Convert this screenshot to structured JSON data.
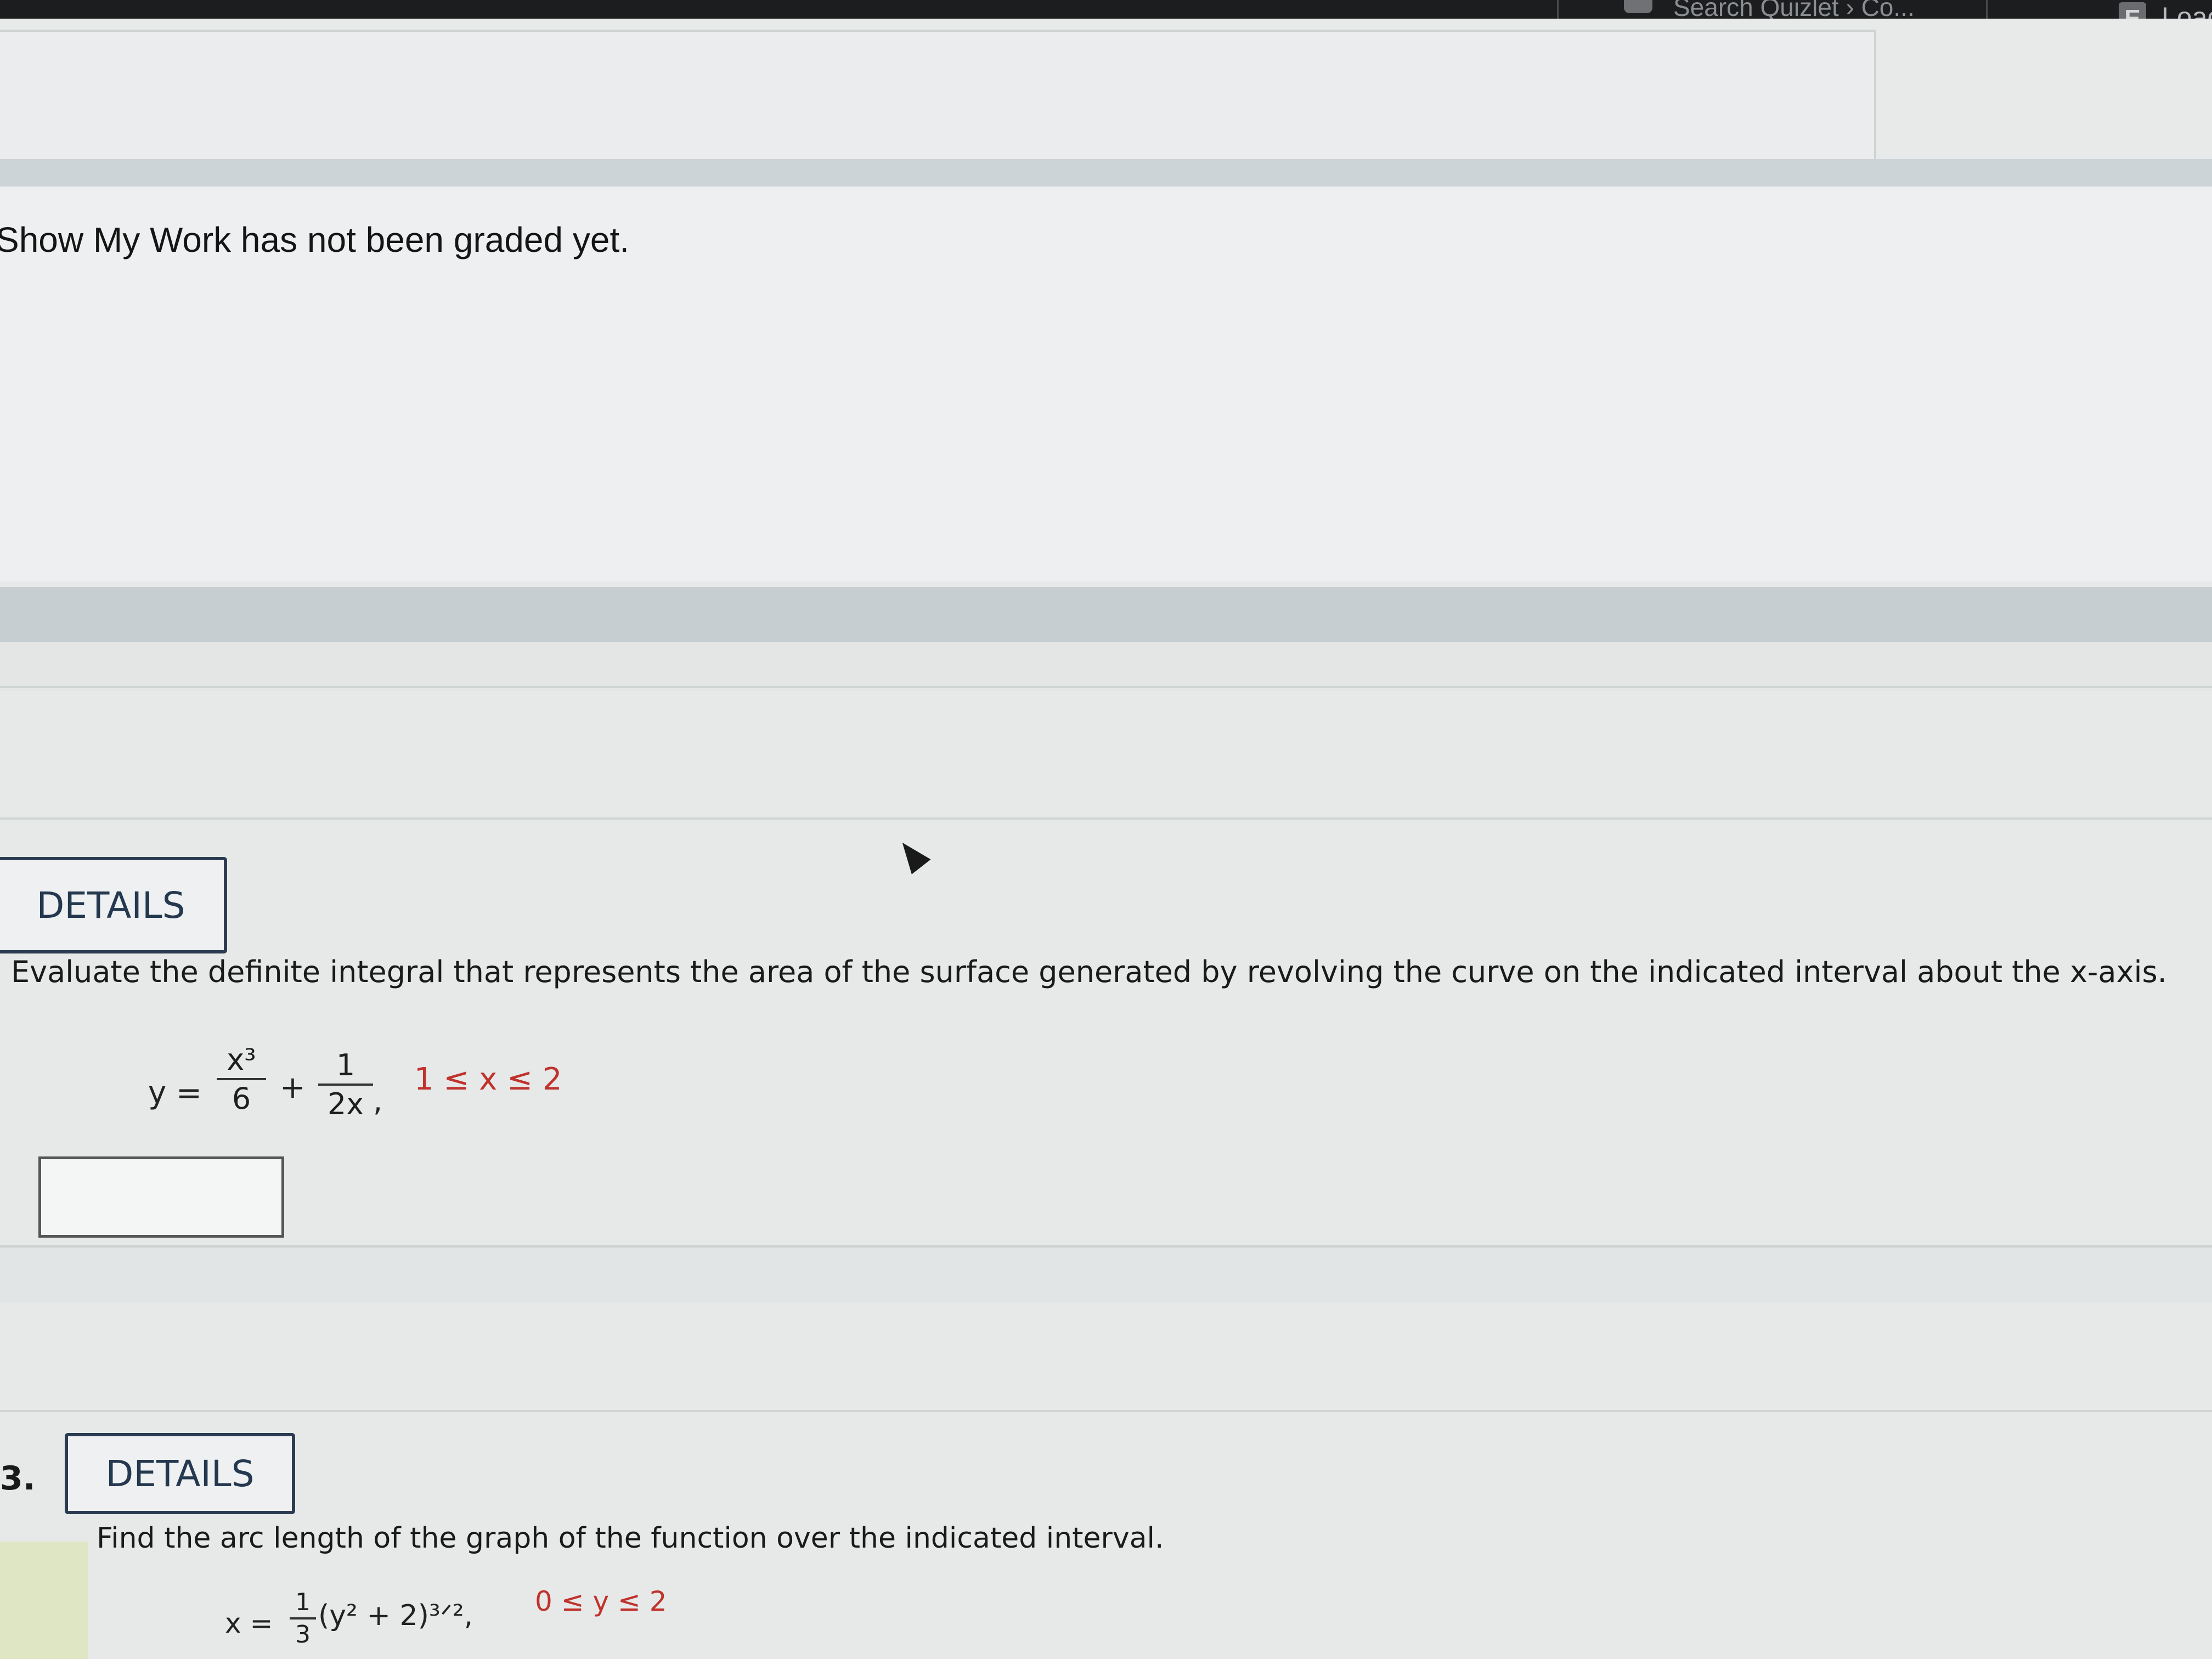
{
  "top_bar": {
    "tab_text": "Search Quizlet › Co...",
    "ext_badge": "E",
    "load_text": "Loac"
  },
  "show_my_work": {
    "status": "Show My Work has not been graded yet."
  },
  "question_2": {
    "details_label": "DETAILS",
    "prompt": "Evaluate the definite integral that represents the area of the surface generated by revolving the curve on the indicated interval about the x-axis.",
    "equation": {
      "lhs": "y =",
      "term1_num": "x³",
      "term1_den": "6",
      "plus": "+",
      "term2_num": "1",
      "term2_den": "2x",
      "comma": ",",
      "interval": "1 ≤ x ≤ 2"
    },
    "answer_value": ""
  },
  "question_3": {
    "number": "3.",
    "details_label": "DETAILS",
    "prompt": "Find the arc length of the graph of the function over the indicated interval.",
    "equation": {
      "lhs": "x =",
      "coef_num": "1",
      "coef_den": "3",
      "body": "(y² + 2)³ᐟ²,",
      "interval": "0 ≤ y ≤ 2"
    }
  },
  "colors": {
    "background": "#e6e9e8",
    "band_dark": "#c9d0d3",
    "details_border": "#2b3b52",
    "interval_red": "#c0322c",
    "bottom_left_tint": "#dfe6c4"
  }
}
